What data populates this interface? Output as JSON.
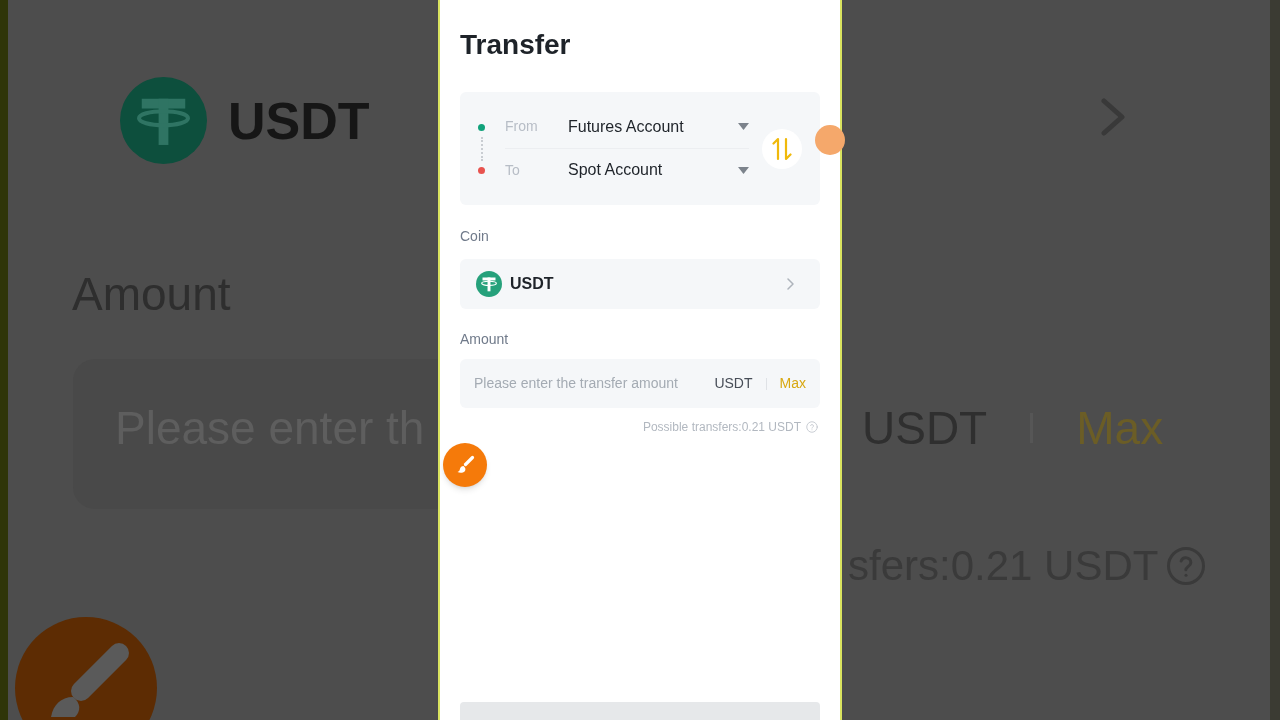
{
  "backdrop": {
    "left": {
      "coin": "USDT",
      "amount_label": "Amount",
      "amount_placeholder": "Please enter th"
    },
    "right": {
      "unit": "USDT",
      "max": "Max",
      "possible_transfers": "sfers:0.21 USDT"
    }
  },
  "screen": {
    "title": "Transfer",
    "accounts": [
      {
        "label": "From",
        "value": "Futures Account",
        "color": "#11a27b"
      },
      {
        "label": "To",
        "value": "Spot Account",
        "color": "#e8534f"
      }
    ],
    "coin": {
      "label": "Coin",
      "value": "USDT"
    },
    "amount": {
      "label": "Amount",
      "placeholder": "Please enter the transfer amount",
      "unit": "USDT",
      "max": "Max"
    },
    "possible_transfers": "Possible transfers:0.21 USDT"
  }
}
